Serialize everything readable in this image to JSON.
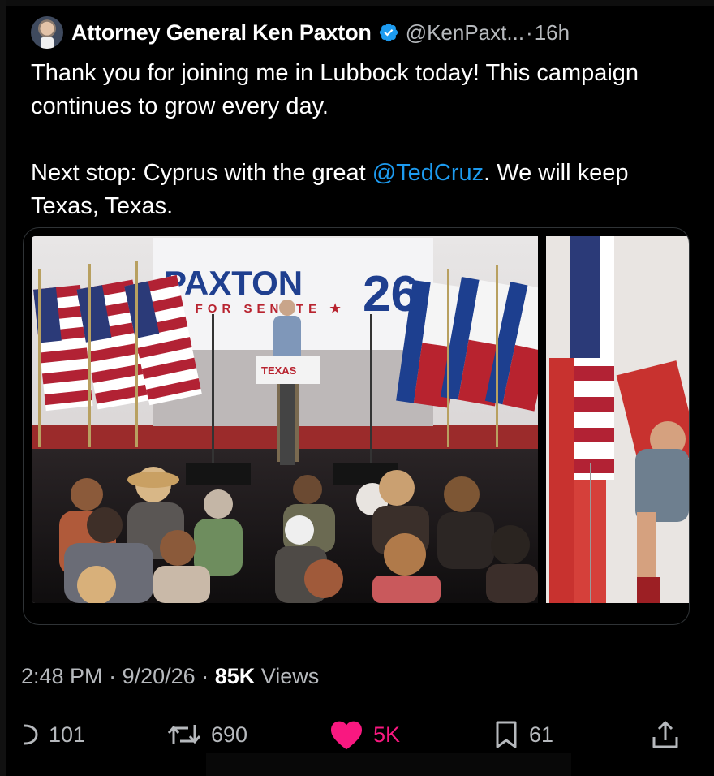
{
  "tweet": {
    "display_name": "Attorney General Ken Paxton",
    "handle": "@KenPaxt...",
    "separator": "·",
    "time": "16h",
    "text_line1": "Thank you for joining me in Lubbock today! This campaign continues to grow every day.",
    "text_line2_before": "Next stop: Cyprus with the great ",
    "mention": "@TedCruz",
    "text_line2_after": ". We will keep Texas, Texas."
  },
  "media": {
    "banner_title": "PAXTON",
    "banner_number": "26",
    "banner_subtitle": "★ FOR SENATE ★",
    "podium_sign": "TEXAS"
  },
  "meta": {
    "time": "2:48 PM",
    "dot1": "·",
    "date": "9/20/26",
    "dot2": "·",
    "views_count": "85K",
    "views_label": "Views"
  },
  "actions": {
    "replies": "101",
    "reposts": "690",
    "likes": "5K",
    "bookmarks": "61"
  },
  "colors": {
    "accent": "#1d9bf0",
    "like": "#f91880",
    "text": "#e7e9ea",
    "secondary": "#b6b9bd",
    "background": "#000000"
  },
  "icons": [
    "verified-badge-icon",
    "reply-icon",
    "repost-icon",
    "heart-icon",
    "bookmark-icon",
    "share-icon"
  ]
}
